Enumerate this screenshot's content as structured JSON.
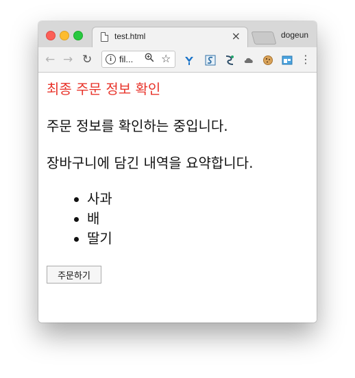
{
  "browser": {
    "tab_title": "test.html",
    "tab_close": "×",
    "profile_name": "dogeun",
    "url_text": "fil...",
    "icons": [
      "back-arrow-icon",
      "forward-arrow-icon",
      "reload-icon",
      "info-icon",
      "zoom-icon",
      "star-icon",
      "menu-icon"
    ],
    "extensions": [
      "extension-y-icon",
      "extension-s-icon",
      "extension-swirl-icon",
      "extension-cloud-icon",
      "extension-cookie-icon",
      "extension-window-icon"
    ]
  },
  "page": {
    "heading": "최종 주문 정보 확인",
    "paragraph_1": "주문 정보를 확인하는 중입니다.",
    "paragraph_2": "장바구니에 담긴 내역을 요약합니다.",
    "items": [
      "사과",
      "배",
      "딸기"
    ],
    "order_button": "주문하기"
  },
  "colors": {
    "heading": "#e8342b",
    "traffic_close": "#fc5f57",
    "traffic_minimize": "#fdbc2e",
    "traffic_maximize": "#28c840"
  }
}
